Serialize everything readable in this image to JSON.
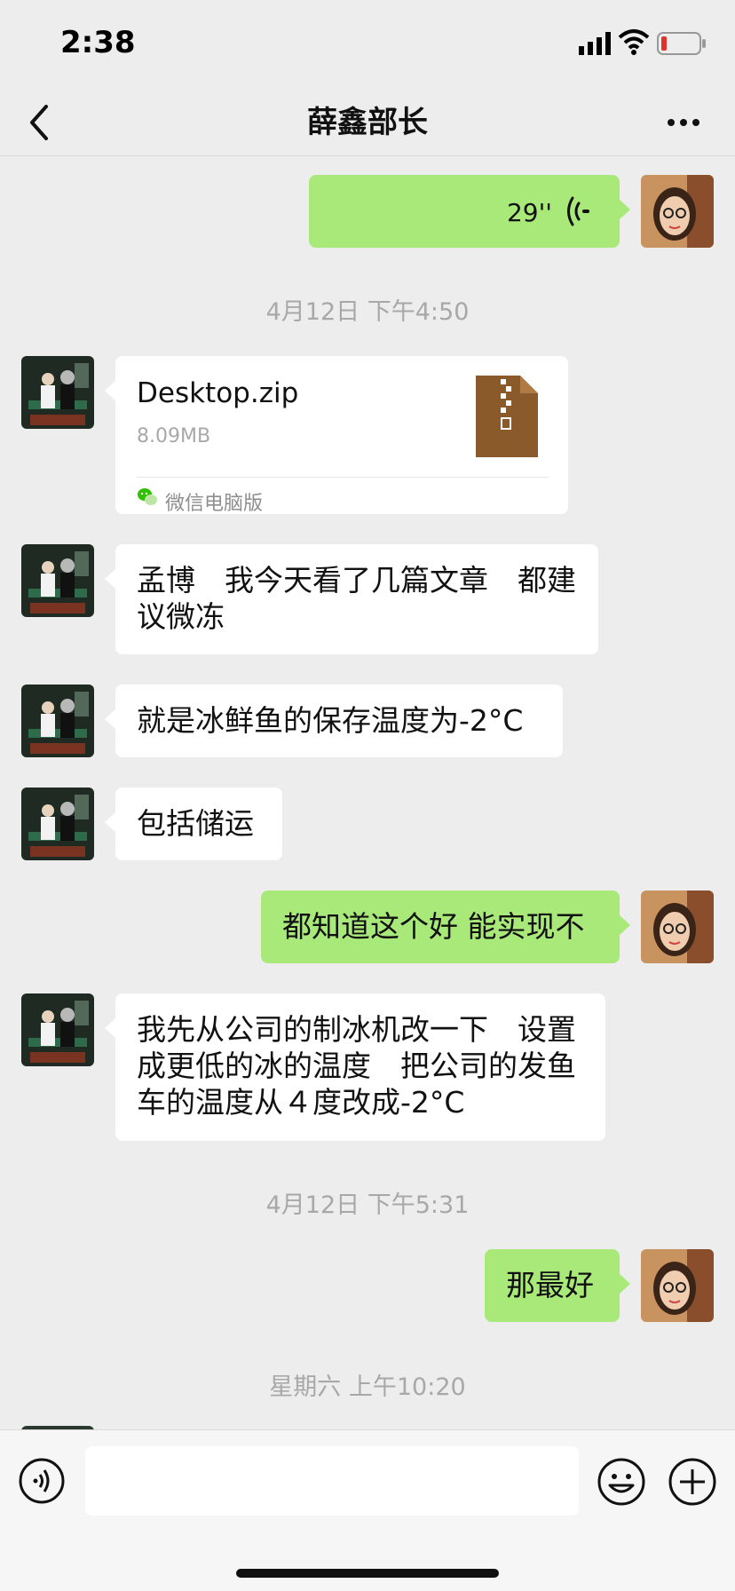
{
  "status_bar": {
    "time": "2:38"
  },
  "header": {
    "title": "薛鑫部长"
  },
  "colors": {
    "outgoing_bubble": "#a9e97a",
    "incoming_bubble": "#ffffff",
    "background": "#ededed",
    "zip_brown": "#8b5a2b"
  },
  "messages": {
    "voice": {
      "duration": "29''"
    },
    "ts1": "4月12日 下午4:50",
    "file": {
      "name": "Desktop.zip",
      "size": "8.09MB",
      "source": "微信电脑版"
    },
    "m1": "孟博　我今天看了几篇文章　都建议微冻",
    "m2": "就是冰鲜鱼的保存温度为-2°C",
    "m3": "包括储运",
    "m4": "都知道这个好 能实现不",
    "m5": "我先从公司的制冰机改一下　设置成更低的冰的温度　把公司的发鱼车的温度从４度改成-2°C",
    "ts2": "4月12日 下午5:31",
    "m6": "那最好",
    "ts3": "星期六 上午10:20"
  },
  "input": {
    "placeholder": ""
  }
}
